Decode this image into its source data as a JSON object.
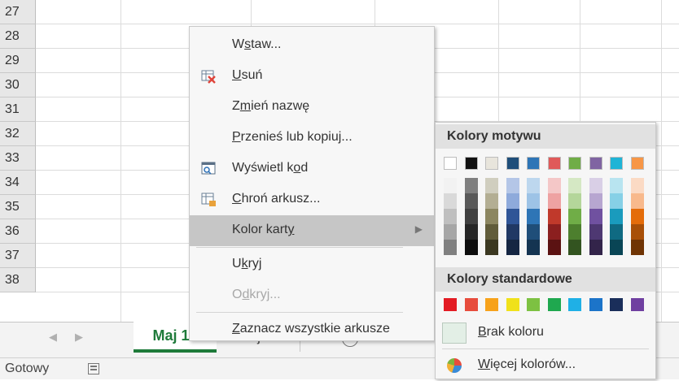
{
  "rows": [
    "27",
    "28",
    "29",
    "30",
    "31",
    "32",
    "33",
    "34",
    "35",
    "36",
    "37",
    "38"
  ],
  "sheet_tabs": {
    "active": "Maj 12",
    "second": "Maj 13",
    "add_symbol": "+"
  },
  "status": {
    "text": "Gotowy"
  },
  "context_menu": {
    "items": [
      {
        "pre": "W",
        "u": "s",
        "post": "taw...",
        "disabled": false
      },
      {
        "pre": "",
        "u": "U",
        "post": "suń",
        "disabled": false
      },
      {
        "pre": "Z",
        "u": "m",
        "post": "ień nazwę",
        "disabled": false
      },
      {
        "pre": "",
        "u": "P",
        "post": "rzenieś lub kopiuj...",
        "disabled": false
      },
      {
        "pre": "Wyświetl k",
        "u": "o",
        "post": "d",
        "disabled": false
      },
      {
        "pre": "",
        "u": "C",
        "post": "hroń arkusz...",
        "disabled": false
      },
      {
        "pre": "Kolor kart",
        "u": "y",
        "post": "",
        "disabled": false
      },
      {
        "pre": "U",
        "u": "k",
        "post": "ryj",
        "disabled": false
      },
      {
        "pre": "O",
        "u": "d",
        "post": "kryj...",
        "disabled": true
      },
      {
        "pre": "",
        "u": "Z",
        "post": "aznacz wszystkie arkusze",
        "disabled": false
      }
    ]
  },
  "submenu": {
    "theme_header": "Kolory motywu",
    "standard_header": "Kolory standardowe",
    "no_color": {
      "pre": "",
      "u": "B",
      "post": "rak koloru"
    },
    "more_colors": {
      "pre": "",
      "u": "W",
      "post": "ięcej kolorów..."
    },
    "theme_base": [
      "#ffffff",
      "#000000",
      "#e7e6e6",
      "#44546a",
      "#4472c4",
      "#ed7d31",
      "#a5a5a5",
      "#ffc000",
      "#5b9bd5",
      "#70ad47"
    ],
    "theme_top": [
      "#ffffff",
      "#111111",
      "#e8e5dc",
      "#1f4e79",
      "#2e75b6",
      "#e05a5a",
      "#70ad47",
      "#8064a2",
      "#1fb4d6",
      "#f79646"
    ],
    "theme_shades": [
      [
        "#f2f2f2",
        "#d9d9d9",
        "#bfbfbf",
        "#a6a6a6",
        "#808080"
      ],
      [
        "#7f7f7f",
        "#595959",
        "#404040",
        "#262626",
        "#0d0d0d"
      ],
      [
        "#d0cebf",
        "#b3ae93",
        "#8c8660",
        "#615c3a",
        "#3b3821"
      ],
      [
        "#b4c6e7",
        "#8eaadb",
        "#2f5597",
        "#203864",
        "#152642"
      ],
      [
        "#bdd7ee",
        "#9dc3e6",
        "#2e75b6",
        "#1f4e79",
        "#143451"
      ],
      [
        "#f4c7c7",
        "#eea2a2",
        "#c0392b",
        "#8b1f1f",
        "#5b1212"
      ],
      [
        "#d5e8c4",
        "#b4d69a",
        "#70ad47",
        "#4d7f2e",
        "#335420"
      ],
      [
        "#d9cfe6",
        "#b7a6d0",
        "#7051a0",
        "#4e3872",
        "#33244a"
      ],
      [
        "#b8e4f0",
        "#86d0e6",
        "#1a9bbd",
        "#0f6a82",
        "#094555"
      ],
      [
        "#fbdac4",
        "#f8b98c",
        "#e46c0a",
        "#a84f07",
        "#6f3404"
      ]
    ],
    "standard": [
      "#e31b23",
      "#e74c3c",
      "#f7a21b",
      "#f0e11a",
      "#7dc142",
      "#1fa84f",
      "#1fb0e6",
      "#1c74c9",
      "#1a2e5a",
      "#6f3fa0"
    ]
  }
}
